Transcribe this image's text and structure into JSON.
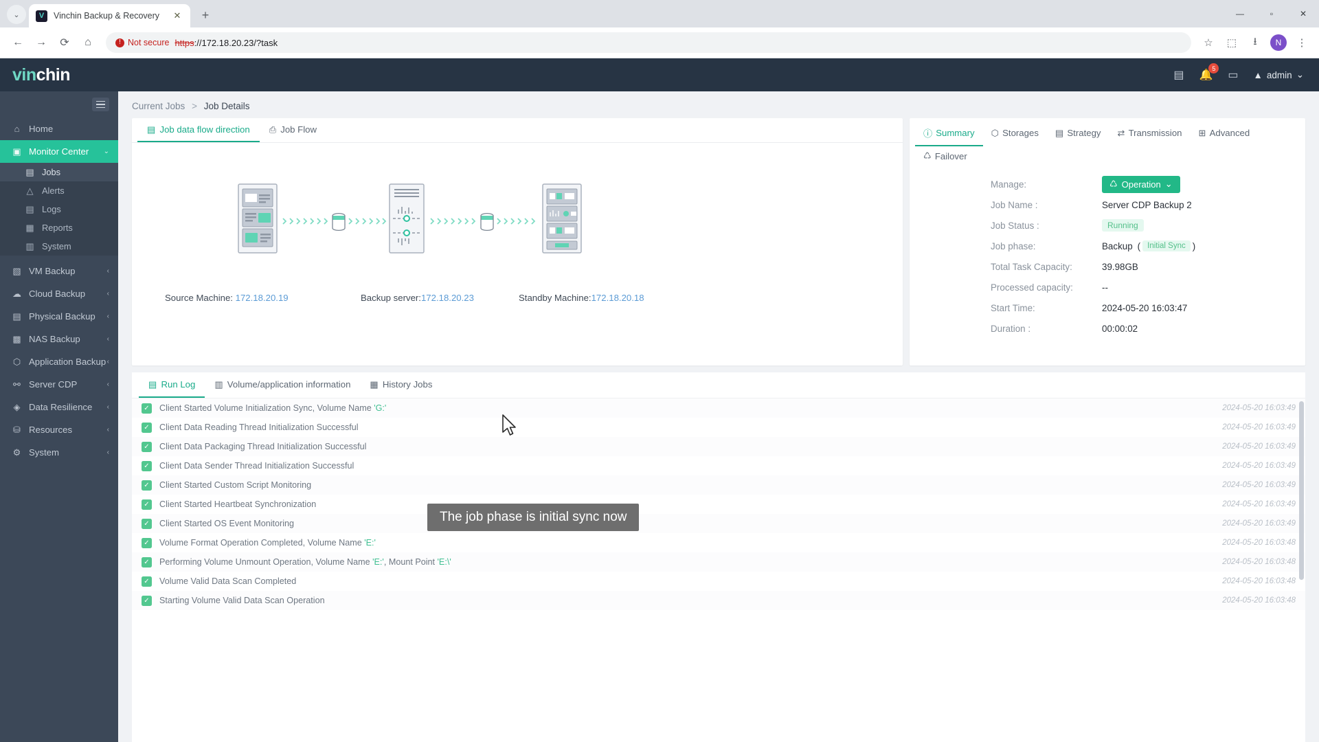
{
  "browser": {
    "tab_title": "Vinchin Backup & Recovery",
    "favicon_letter": "V",
    "tab_close": "✕",
    "new_tab": "+",
    "chevron": "⌄",
    "back": "←",
    "forward": "→",
    "reload": "⟳",
    "home": "⌂",
    "security_label": "Not secure",
    "url_scheme": "https",
    "url_rest": "://172.18.20.23/?task",
    "star": "☆",
    "extensions": "⬚",
    "download": "⭳",
    "profile": "N",
    "menu": "⋮",
    "win_min": "—",
    "win_max": "▫",
    "win_close": "✕"
  },
  "topbar": {
    "logo_first": "vin",
    "logo_second": "chin",
    "doc_icon": "▤",
    "bell_icon": "🔔",
    "bell_badge": "5",
    "screen_icon": "▭",
    "user_icon": "▲",
    "user_name": "admin",
    "user_caret": "⌄"
  },
  "sidebar": {
    "items": [
      {
        "label": "Home",
        "icon": "⌂",
        "state": "normal",
        "arrow": ""
      },
      {
        "label": "Monitor Center",
        "icon": "▣",
        "state": "active",
        "arrow": "⌄"
      }
    ],
    "sub_items": [
      {
        "label": "Jobs",
        "icon": "▤",
        "selected": true
      },
      {
        "label": "Alerts",
        "icon": "△",
        "selected": false
      },
      {
        "label": "Logs",
        "icon": "▤",
        "selected": false
      },
      {
        "label": "Reports",
        "icon": "▦",
        "selected": false
      },
      {
        "label": "System",
        "icon": "▥",
        "selected": false
      }
    ],
    "items_after": [
      {
        "label": "VM Backup",
        "icon": "▧",
        "arrow": "‹"
      },
      {
        "label": "Cloud Backup",
        "icon": "☁",
        "arrow": "‹"
      },
      {
        "label": "Physical Backup",
        "icon": "▤",
        "arrow": "‹"
      },
      {
        "label": "NAS Backup",
        "icon": "▩",
        "arrow": "‹"
      },
      {
        "label": "Application Backup",
        "icon": "⬡",
        "arrow": "‹"
      },
      {
        "label": "Server CDP",
        "icon": "⚯",
        "arrow": "‹"
      },
      {
        "label": "Data Resilience",
        "icon": "◈",
        "arrow": "‹"
      },
      {
        "label": "Resources",
        "icon": "⛁",
        "arrow": "‹"
      },
      {
        "label": "System",
        "icon": "⚙",
        "arrow": "‹"
      }
    ]
  },
  "breadcrumb": {
    "parent": "Current Jobs",
    "separator": ">",
    "current": "Job Details"
  },
  "flow_panel": {
    "tabs": [
      {
        "label": "Job data flow direction",
        "icon": "▤",
        "active": true
      },
      {
        "label": "Job Flow",
        "icon": "⎙",
        "active": false
      }
    ],
    "nodes": [
      {
        "role": "Source Machine:",
        "ip": "172.18.20.19"
      },
      {
        "role": "Backup server:",
        "ip": "172.18.20.23"
      },
      {
        "role": "Standby Machine:",
        "ip": "172.18.20.18"
      }
    ]
  },
  "detail_panel": {
    "tabs": [
      {
        "label": "Summary",
        "icon": "ⓘ",
        "active": true
      },
      {
        "label": "Storages",
        "icon": "⬡",
        "active": false
      },
      {
        "label": "Strategy",
        "icon": "▤",
        "active": false
      },
      {
        "label": "Transmission",
        "icon": "⇄",
        "active": false
      },
      {
        "label": "Advanced",
        "icon": "⊞",
        "active": false
      },
      {
        "label": "Failover",
        "icon": "♺",
        "active": false
      }
    ],
    "fields": [
      {
        "label": "Manage:",
        "type": "button",
        "value": "Operation",
        "icon": "♺",
        "caret": "⌄"
      },
      {
        "label": "Job Name :",
        "type": "text",
        "value": "Server CDP Backup 2"
      },
      {
        "label": "Job Status :",
        "type": "pill",
        "value": "Running"
      },
      {
        "label": "Job phase:",
        "type": "phase",
        "value": "Backup",
        "badge": "Initial Sync",
        "open": "(",
        "close": ")"
      },
      {
        "label": "Total Task Capacity:",
        "type": "text",
        "value": "39.98GB"
      },
      {
        "label": "Processed capacity:",
        "type": "text",
        "value": "--"
      },
      {
        "label": "Start Time:",
        "type": "text",
        "value": "2024-05-20 16:03:47"
      },
      {
        "label": "Duration :",
        "type": "text",
        "value": "00:00:02"
      }
    ]
  },
  "log_panel": {
    "tabs": [
      {
        "label": "Run Log",
        "icon": "▤",
        "active": true
      },
      {
        "label": "Volume/application information",
        "icon": "▥",
        "active": false
      },
      {
        "label": "History Jobs",
        "icon": "▦",
        "active": false
      }
    ],
    "entries": [
      {
        "msg_pre": "Client Started Volume Initialization Sync, Volume Name ",
        "hl": "'G:'",
        "msg_post": "",
        "time": "2024-05-20 16:03:49"
      },
      {
        "msg_pre": "Client Data Reading Thread Initialization Successful",
        "hl": "",
        "msg_post": "",
        "time": "2024-05-20 16:03:49"
      },
      {
        "msg_pre": "Client Data Packaging Thread Initialization Successful",
        "hl": "",
        "msg_post": "",
        "time": "2024-05-20 16:03:49"
      },
      {
        "msg_pre": "Client Data Sender Thread Initialization Successful",
        "hl": "",
        "msg_post": "",
        "time": "2024-05-20 16:03:49"
      },
      {
        "msg_pre": "Client Started Custom Script Monitoring",
        "hl": "",
        "msg_post": "",
        "time": "2024-05-20 16:03:49"
      },
      {
        "msg_pre": "Client Started Heartbeat Synchronization",
        "hl": "",
        "msg_post": "",
        "time": "2024-05-20 16:03:49"
      },
      {
        "msg_pre": "Client Started OS Event Monitoring",
        "hl": "",
        "msg_post": "",
        "time": "2024-05-20 16:03:49"
      },
      {
        "msg_pre": "Volume Format Operation Completed, Volume Name ",
        "hl": "'E:'",
        "msg_post": "",
        "time": "2024-05-20 16:03:48"
      },
      {
        "msg_pre": "Performing Volume Unmount Operation, Volume Name ",
        "hl": "'E:'",
        "msg_post": ", Mount Point ",
        "hl2": "'E:\\'",
        "time": "2024-05-20 16:03:48"
      },
      {
        "msg_pre": "Volume Valid Data Scan Completed",
        "hl": "",
        "msg_post": "",
        "time": "2024-05-20 16:03:48"
      },
      {
        "msg_pre": "Starting Volume Valid Data Scan Operation",
        "hl": "",
        "msg_post": "",
        "time": "2024-05-20 16:03:48"
      }
    ]
  },
  "tooltip": {
    "text": "The job phase is initial sync now"
  },
  "colors": {
    "accent": "#1aab8a",
    "sidebar_bg": "#3c4858",
    "topbar_bg": "#273444",
    "active_nav": "#26c29a",
    "success": "#52c78f",
    "link": "#5b9bd5"
  }
}
